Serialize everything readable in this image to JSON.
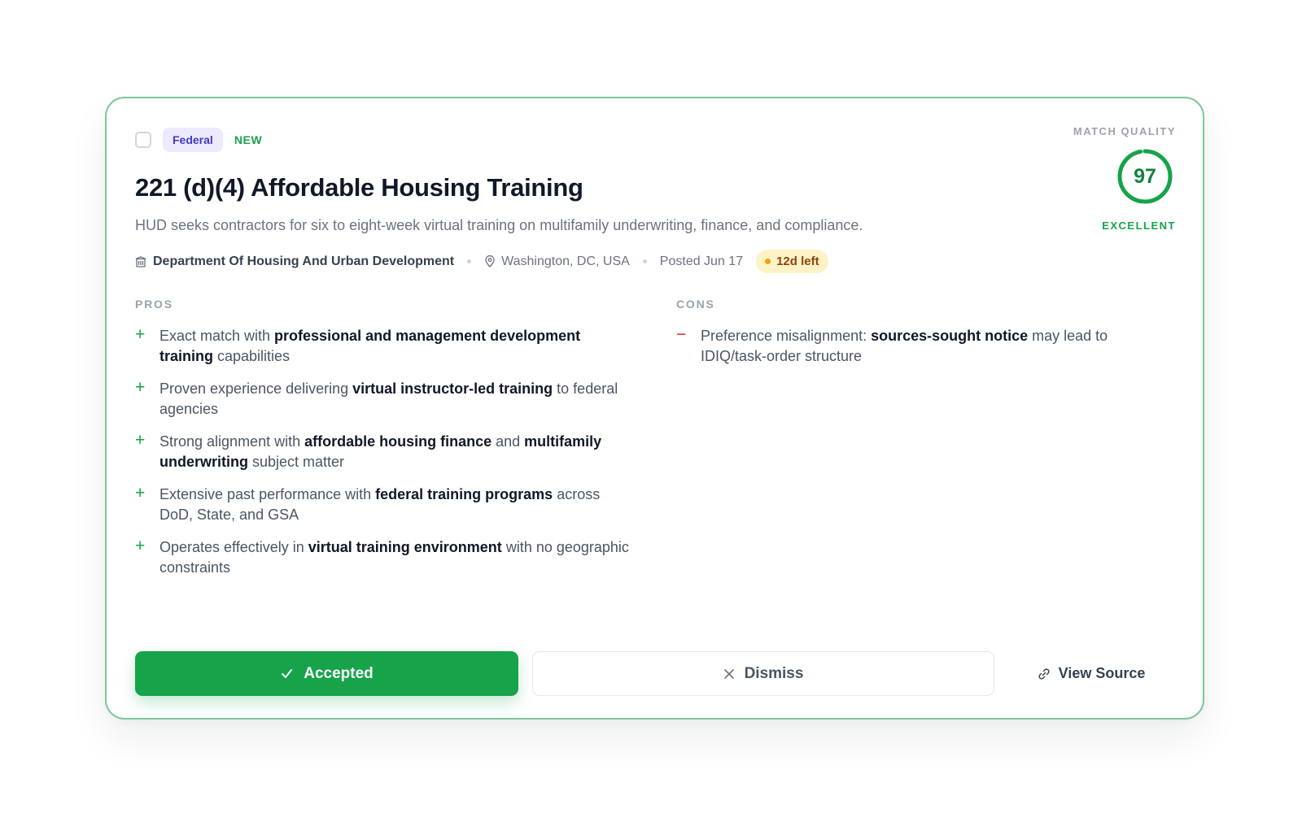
{
  "opportunity": {
    "tags": {
      "category": "Federal",
      "status": "NEW"
    },
    "title": "221 (d)(4) Affordable Housing Training",
    "summary": "HUD seeks contractors for six to eight-week virtual training on multifamily underwriting, finance, and compliance.",
    "meta": {
      "agency": "Department Of Housing And Urban Development",
      "location": "Washington, DC, USA",
      "posted": "Posted Jun 17",
      "deadline": "12d left"
    }
  },
  "match": {
    "label": "MATCH QUALITY",
    "score": "97",
    "score_fraction": 0.97,
    "rating": "EXCELLENT",
    "color": "#16a34a"
  },
  "pros": {
    "label": "PROS",
    "items": [
      {
        "mark": "+",
        "parts": [
          {
            "t": "Exact match with "
          },
          {
            "t": "professional and management development training",
            "b": true
          },
          {
            "t": " capabilities"
          }
        ]
      },
      {
        "mark": "+",
        "parts": [
          {
            "t": "Proven experience delivering "
          },
          {
            "t": "virtual instructor-led training",
            "b": true
          },
          {
            "t": " to federal agencies"
          }
        ]
      },
      {
        "mark": "+",
        "parts": [
          {
            "t": "Strong alignment with "
          },
          {
            "t": "affordable housing finance",
            "b": true
          },
          {
            "t": " and "
          },
          {
            "t": "multifamily underwriting",
            "b": true
          },
          {
            "t": " subject matter"
          }
        ]
      },
      {
        "mark": "+",
        "parts": [
          {
            "t": "Extensive past performance with "
          },
          {
            "t": "federal training programs",
            "b": true
          },
          {
            "t": " across DoD, State, and GSA"
          }
        ]
      },
      {
        "mark": "+",
        "parts": [
          {
            "t": "Operates effectively in "
          },
          {
            "t": "virtual training environment",
            "b": true
          },
          {
            "t": " with no geographic constraints"
          }
        ]
      }
    ]
  },
  "cons": {
    "label": "CONS",
    "items": [
      {
        "mark": "−",
        "parts": [
          {
            "t": "Preference misalignment: "
          },
          {
            "t": "sources-sought notice",
            "b": true
          },
          {
            "t": " may lead to IDIQ/task-order structure"
          }
        ]
      }
    ]
  },
  "actions": {
    "accept_label": "Accepted",
    "dismiss_label": "Dismiss",
    "source_label": "View Source"
  },
  "icons": {
    "agency": "building-icon",
    "location": "map-pin-icon",
    "accept": "check-icon",
    "dismiss": "close-icon",
    "source": "link-icon"
  },
  "colors": {
    "accent": "#16a34a",
    "card_border": "#7fc79a",
    "federal_tag_bg": "#eceafc",
    "federal_tag_text": "#4338ca",
    "deadline_bg": "#fef3c7",
    "deadline_text": "#92400e",
    "cons_mark": "#dc2626"
  }
}
